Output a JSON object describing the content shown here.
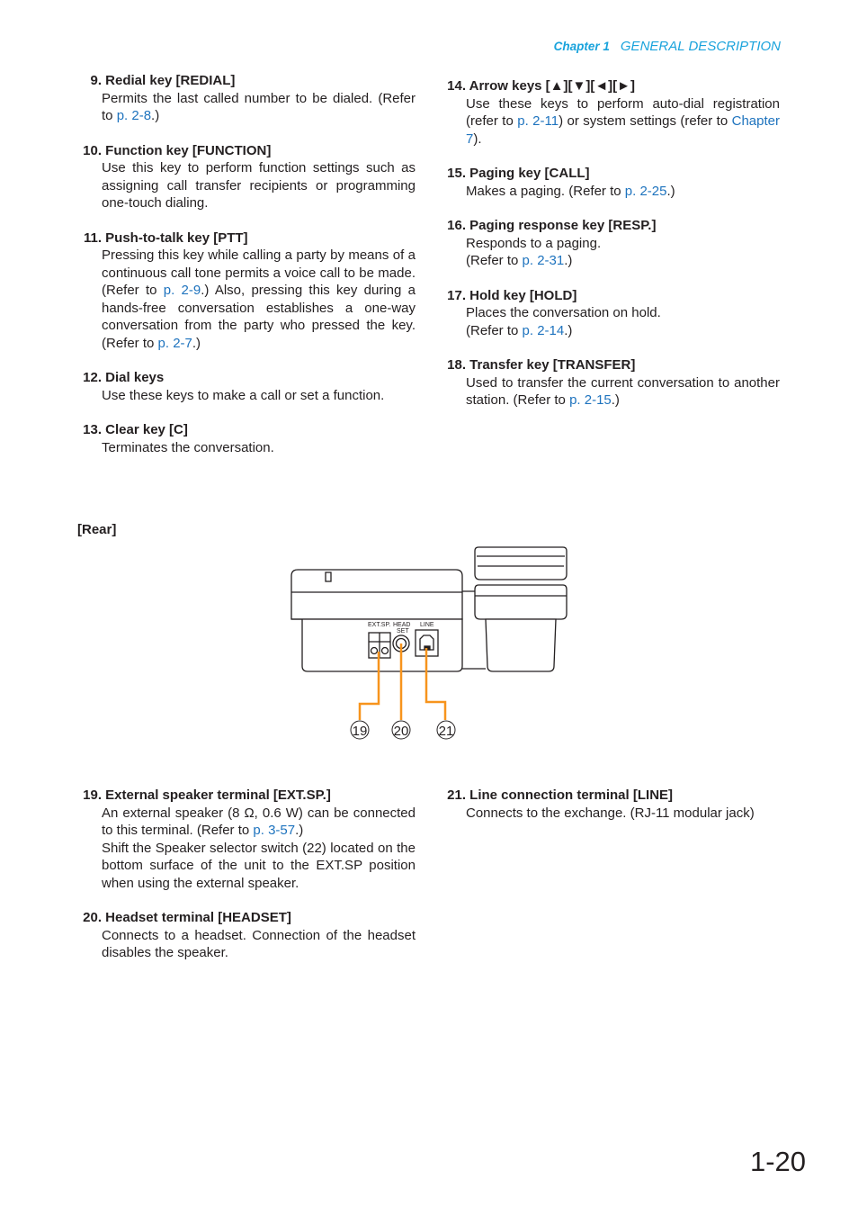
{
  "header": {
    "chapter": "Chapter 1",
    "section": "GENERAL DESCRIPTION"
  },
  "left_items": [
    {
      "num": "9.",
      "title": "Redial key [REDIAL]",
      "body": [
        {
          "t": "Permits the last called number to be dialed. (Refer to "
        },
        {
          "t": "p. 2-8",
          "link": true
        },
        {
          "t": ".)"
        }
      ]
    },
    {
      "num": "10.",
      "title": "Function key [FUNCTION]",
      "body": [
        {
          "t": "Use this key to perform function settings such as assigning call transfer recipients or programming one-touch dialing."
        }
      ]
    },
    {
      "num": "11.",
      "title": "Push-to-talk key [PTT]",
      "body": [
        {
          "t": "Pressing this key while calling a party by means of a continuous call tone permits a voice call to be made. (Refer to "
        },
        {
          "t": "p. 2-9",
          "link": true
        },
        {
          "t": ".) Also, pressing this key during a hands-free conversation establishes a one-way conversation from the party who pressed the key. (Refer to "
        },
        {
          "t": "p. 2-7",
          "link": true
        },
        {
          "t": ".)"
        }
      ]
    },
    {
      "num": "12.",
      "title": "Dial keys",
      "body": [
        {
          "t": "Use these keys to make a call or set a function."
        }
      ]
    },
    {
      "num": "13.",
      "title": "Clear key [C]",
      "body": [
        {
          "t": "Terminates the conversation."
        }
      ]
    }
  ],
  "right_items": [
    {
      "num": "14.",
      "title": "Arrow keys [▲][▼][◄][►]",
      "body": [
        {
          "t": "Use these keys to perform auto-dial registration (refer to "
        },
        {
          "t": "p. 2-11",
          "link": true
        },
        {
          "t": ") or system settings (refer to "
        },
        {
          "t": "Chapter 7",
          "link": true
        },
        {
          "t": ")."
        }
      ]
    },
    {
      "num": "15.",
      "title": "Paging key [CALL]",
      "body": [
        {
          "t": "Makes a paging. (Refer to "
        },
        {
          "t": "p. 2-25",
          "link": true
        },
        {
          "t": ".)"
        }
      ]
    },
    {
      "num": "16.",
      "title": "Paging response key [RESP.]",
      "body": [
        {
          "t": "Responds to a paging.",
          "br": true
        },
        {
          "t": "(Refer to "
        },
        {
          "t": "p. 2-31",
          "link": true
        },
        {
          "t": ".)"
        }
      ]
    },
    {
      "num": "17.",
      "title": "Hold key [HOLD]",
      "body": [
        {
          "t": "Places the conversation on hold.",
          "br": true
        },
        {
          "t": "(Refer to "
        },
        {
          "t": "p. 2-14",
          "link": true
        },
        {
          "t": ".)"
        }
      ]
    },
    {
      "num": "18.",
      "title": "Transfer key [TRANSFER]",
      "body": [
        {
          "t": "Used to transfer the current conversation to another station. (Refer to "
        },
        {
          "t": "p. 2-15",
          "link": true
        },
        {
          "t": ".)"
        }
      ]
    }
  ],
  "rear_label": "[Rear]",
  "diagram": {
    "labels": {
      "ext_sp": "EXT.SP.",
      "head": "HEAD",
      "set": "SET",
      "line": "LINE"
    },
    "callouts": [
      "19",
      "20",
      "21"
    ],
    "callout_color": "#f7941d"
  },
  "bottom_left_items": [
    {
      "num": "19.",
      "title": "External speaker terminal [EXT.SP.]",
      "body": [
        {
          "t": "An external speaker (8 Ω, 0.6 W) can be connected to this terminal. (Refer to "
        },
        {
          "t": "p. 3-57",
          "link": true
        },
        {
          "t": ".)",
          "br": true
        },
        {
          "t": "Shift the Speaker selector switch (22) located on the bottom surface of the unit to the EXT.SP position when using the external speaker."
        }
      ]
    },
    {
      "num": "20.",
      "title": "Headset terminal [HEADSET]",
      "body": [
        {
          "t": "Connects to a headset. Connection of the headset disables the speaker."
        }
      ]
    }
  ],
  "bottom_right_items": [
    {
      "num": "21.",
      "title": "Line connection terminal [LINE]",
      "body": [
        {
          "t": "Connects to the exchange. (RJ-11 modular jack)"
        }
      ]
    }
  ],
  "page_number": "1-20"
}
